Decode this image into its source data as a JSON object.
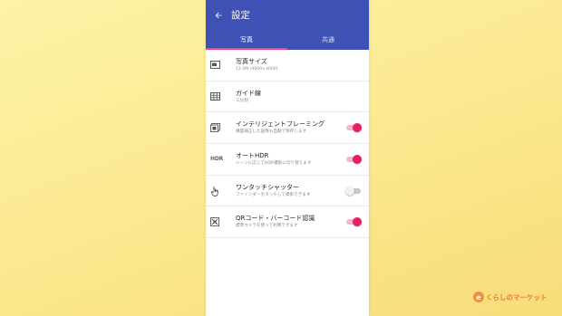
{
  "app": {
    "title": "設定",
    "back_icon": "arrow-back-icon"
  },
  "tabs": [
    {
      "label": "写真",
      "active": true
    },
    {
      "label": "共通",
      "active": false
    }
  ],
  "settings": [
    {
      "title": "写真サイズ",
      "subtitle": "12.0M (4000×3000)",
      "icon": "photo-size-icon",
      "toggle": null
    },
    {
      "title": "ガイド線",
      "subtitle": "三分割",
      "icon": "grid-icon",
      "toggle": null
    },
    {
      "title": "インテリジェントフレーミング",
      "subtitle": "構図補正した画像も自動で保存します",
      "icon": "framing-icon",
      "toggle": true
    },
    {
      "title": "オートHDR",
      "subtitle": "シーンに応じてHDR撮影に切り替えます",
      "icon": "hdr-icon",
      "icon_text": "HDR",
      "toggle": true
    },
    {
      "title": "ワンタッチシャッター",
      "subtitle": "ファインダーをタッチして撮影できます",
      "icon": "touch-icon",
      "toggle": false
    },
    {
      "title": "QRコード・バーコード認識",
      "subtitle": "標準カメラを使って利用できます",
      "icon": "qr-code-icon",
      "toggle": true
    }
  ],
  "watermark": {
    "text": "くらしのマーケット",
    "mark": "e"
  },
  "colors": {
    "appbar": "#3f51b5",
    "accent": "#e91e63",
    "indicator": "#ff4081"
  }
}
